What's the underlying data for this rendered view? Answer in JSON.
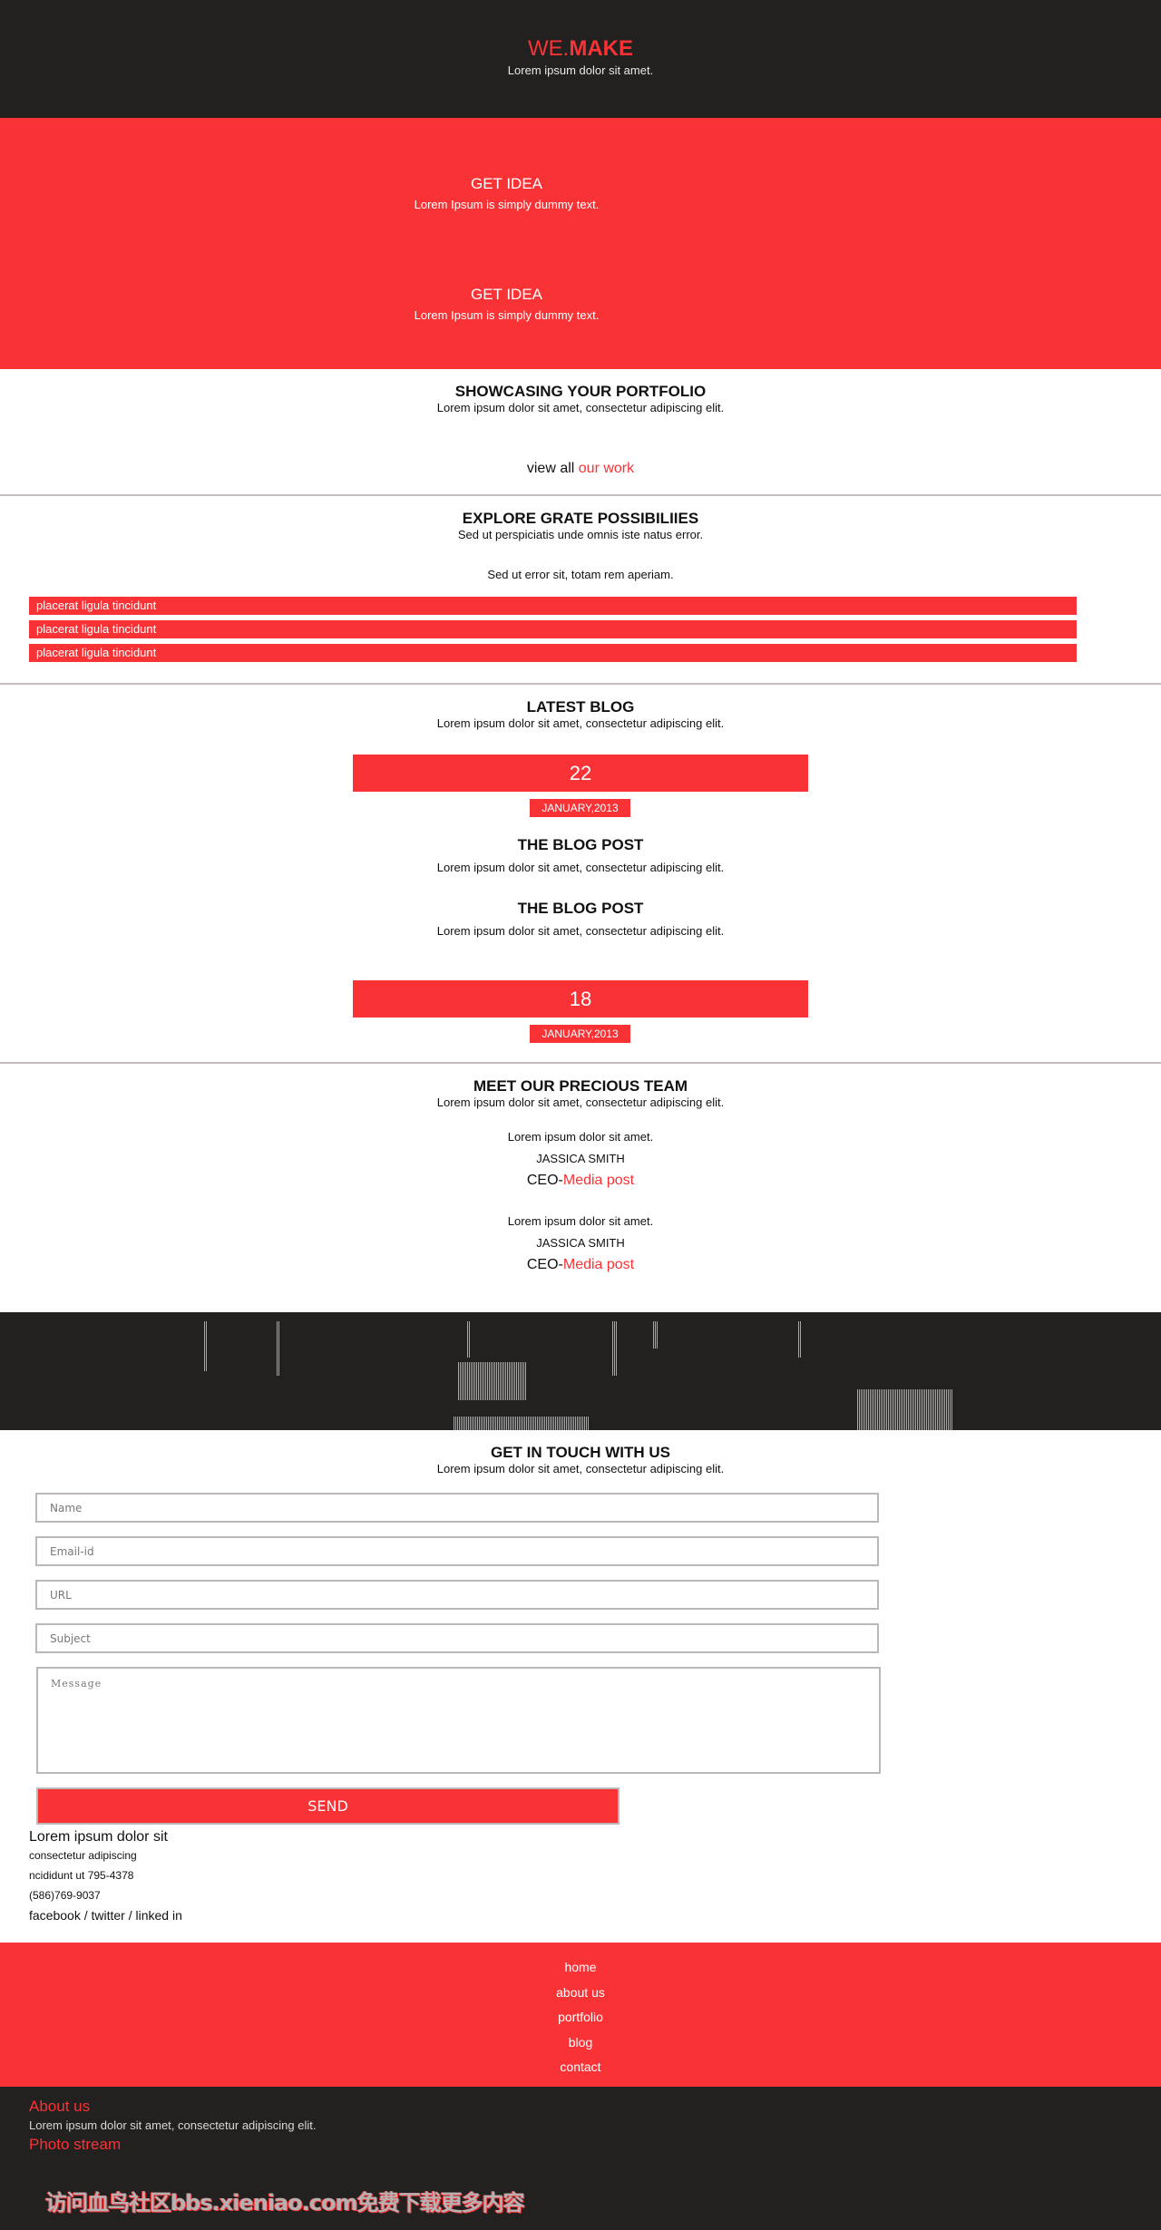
{
  "colors": {
    "accent": "#f93236",
    "dark": "#222120",
    "rule": "#c4bcbd"
  },
  "header": {
    "logo_prefix": "WE.",
    "logo_strong": "MAKE",
    "tagline": "Lorem ipsum dolor sit amet."
  },
  "hero": {
    "items": [
      {
        "title": "GET IDEA",
        "text": "Lorem Ipsum is simply dummy text."
      },
      {
        "title": "GET IDEA",
        "text": "Lorem Ipsum is simply dummy text."
      }
    ]
  },
  "portfolio": {
    "title": "SHOWCASING YOUR PORTFOLIO",
    "subtitle": "Lorem ipsum dolor sit amet, consectetur adipiscing elit.",
    "view_all_prefix": "view all ",
    "view_all_link": "our work"
  },
  "explore": {
    "title": "EXPLORE GRATE POSSIBILIIES",
    "subtitle": "Sed ut perspiciatis unde omnis iste natus error.",
    "subtitle2": "Sed ut error sit, totam rem aperiam.",
    "bars": [
      "placerat ligula tincidunt",
      "placerat ligula tincidunt",
      "placerat ligula tincidunt"
    ]
  },
  "blog": {
    "title": "LATEST BLOG",
    "subtitle": "Lorem ipsum dolor sit amet, consectetur adipiscing elit.",
    "dates": [
      {
        "day": "22",
        "month": "JANUARY,2013"
      },
      {
        "day": "18",
        "month": "JANUARY,2013"
      }
    ],
    "posts": [
      {
        "title": "THE BLOG POST",
        "text": "Lorem ipsum dolor sit amet, consectetur adipiscing elit."
      },
      {
        "title": "THE BLOG POST",
        "text": "Lorem ipsum dolor sit amet, consectetur adipiscing elit."
      }
    ]
  },
  "team": {
    "title": "MEET OUR PRECIOUS TEAM",
    "subtitle": "Lorem ipsum dolor sit amet, consectetur adipiscing elit.",
    "members": [
      {
        "bio": "Lorem ipsum dolor sit amet.",
        "name": "JASSICA SMITH",
        "role_prefix": "CEO-",
        "role_company": "Media post"
      },
      {
        "bio": "Lorem ipsum dolor sit amet.",
        "name": "JASSICA SMITH",
        "role_prefix": "CEO-",
        "role_company": "Media post"
      }
    ]
  },
  "contact": {
    "title": "GET IN TOUCH WITH US",
    "subtitle": "Lorem ipsum dolor sit amet, consectetur adipiscing elit.",
    "fields": {
      "name_placeholder": "Name",
      "email_placeholder": "Email-id",
      "url_placeholder": "URL",
      "subject_placeholder": "Subject",
      "message_placeholder": "Message"
    },
    "send_label": "SEND",
    "address": {
      "line1": "Lorem ipsum dolor sit",
      "line2": "consectetur adipiscing",
      "line3": "ncididunt ut 795-4378",
      "phone": "(586)769-9037"
    },
    "social": {
      "facebook": "facebook",
      "twitter": "twitter",
      "linkedin": "linked in",
      "separator": " / "
    }
  },
  "footer_nav": [
    "home",
    "about us",
    "portfolio",
    "blog",
    "contact"
  ],
  "footer": {
    "about_title": "About us",
    "about_text": "Lorem ipsum dolor sit amet, consectetur adipiscing elit.",
    "photo_title": "Photo stream",
    "watermark": "访问血鸟社区bbs.xieniao.com免费下载更多内容"
  }
}
